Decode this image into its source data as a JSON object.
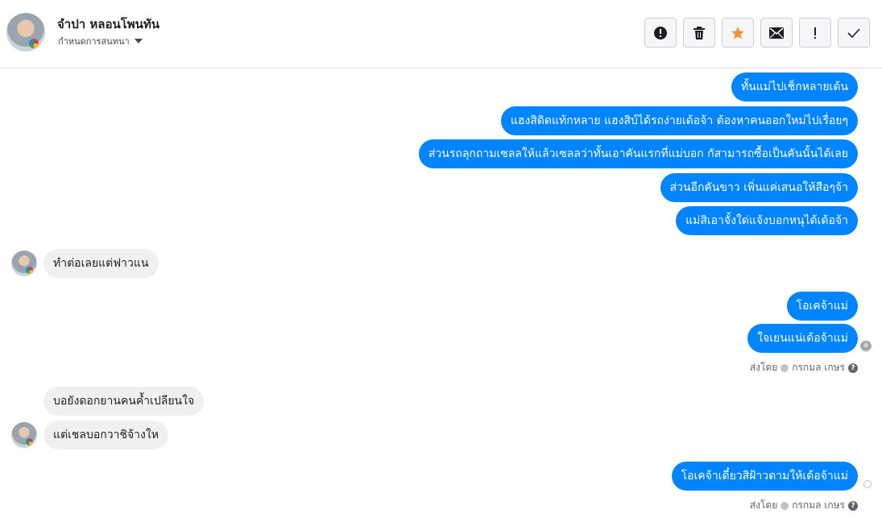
{
  "header": {
    "contact_name": "จำปา หลอนโพนทัน",
    "settings_label": "กำหนดการสนทนา"
  },
  "toolbar": {
    "buttons": [
      {
        "name": "report-button",
        "icon": "alert-circle-icon"
      },
      {
        "name": "delete-button",
        "icon": "trash-icon"
      },
      {
        "name": "star-button",
        "icon": "star-icon"
      },
      {
        "name": "mark-unread-button",
        "icon": "envelope-icon"
      },
      {
        "name": "important-button",
        "icon": "exclamation-icon"
      },
      {
        "name": "done-button",
        "icon": "check-icon"
      }
    ]
  },
  "messages": [
    {
      "dir": "out",
      "text": "ทั้นแม่ไปเช็กหลายเด้น"
    },
    {
      "dir": "out",
      "text": "แฮงสิดิดแท้กหลาย แฮงสิบ์ได้รถง่ายเด้อจ้า  ต้องหาคนออกใหม่ไปเรื่อยๆ"
    },
    {
      "dir": "out",
      "text": "ส่วนรถลุกถามเซลลให้แล้วเซลลว่าทั้นเอาคันแรกที่แม่บอก  กัสามารถซื้อเป็นคันนั้นได้เลย"
    },
    {
      "dir": "out",
      "text": "ส่วนอีกคันขาว เพิ่นแค่เสนอให้สือๆจ้า"
    },
    {
      "dir": "out",
      "text": "แม่สิเอาจั้งใด่แจ้งบอกหนุได้เด้อจ้า"
    },
    {
      "dir": "in",
      "text": "ทำต่อเลยแต่ฟาวแน"
    },
    {
      "dir": "out",
      "text": "โอเคจ้าแม่"
    },
    {
      "dir": "out",
      "text": "ใจเยนแน่เด้อจ้าแม่"
    },
    {
      "dir": "in",
      "text": "บอยังดอกยานคนค้ำเปลียนใจ"
    },
    {
      "dir": "in",
      "text": "แต่เชลบอกวาชิจ้างให"
    },
    {
      "dir": "out",
      "text": "โอเคจ้าเดี๋ยวสิฝ้าวตามให้เด้อจ้าแม่"
    }
  ],
  "sent_by": {
    "prefix": "ส่งโดย",
    "name": "กรกมล เกษร",
    "help": "?"
  },
  "colors": {
    "outgoing_bubble": "#0084ff",
    "incoming_bubble": "#f1f0f0",
    "star": "#f7923a"
  }
}
